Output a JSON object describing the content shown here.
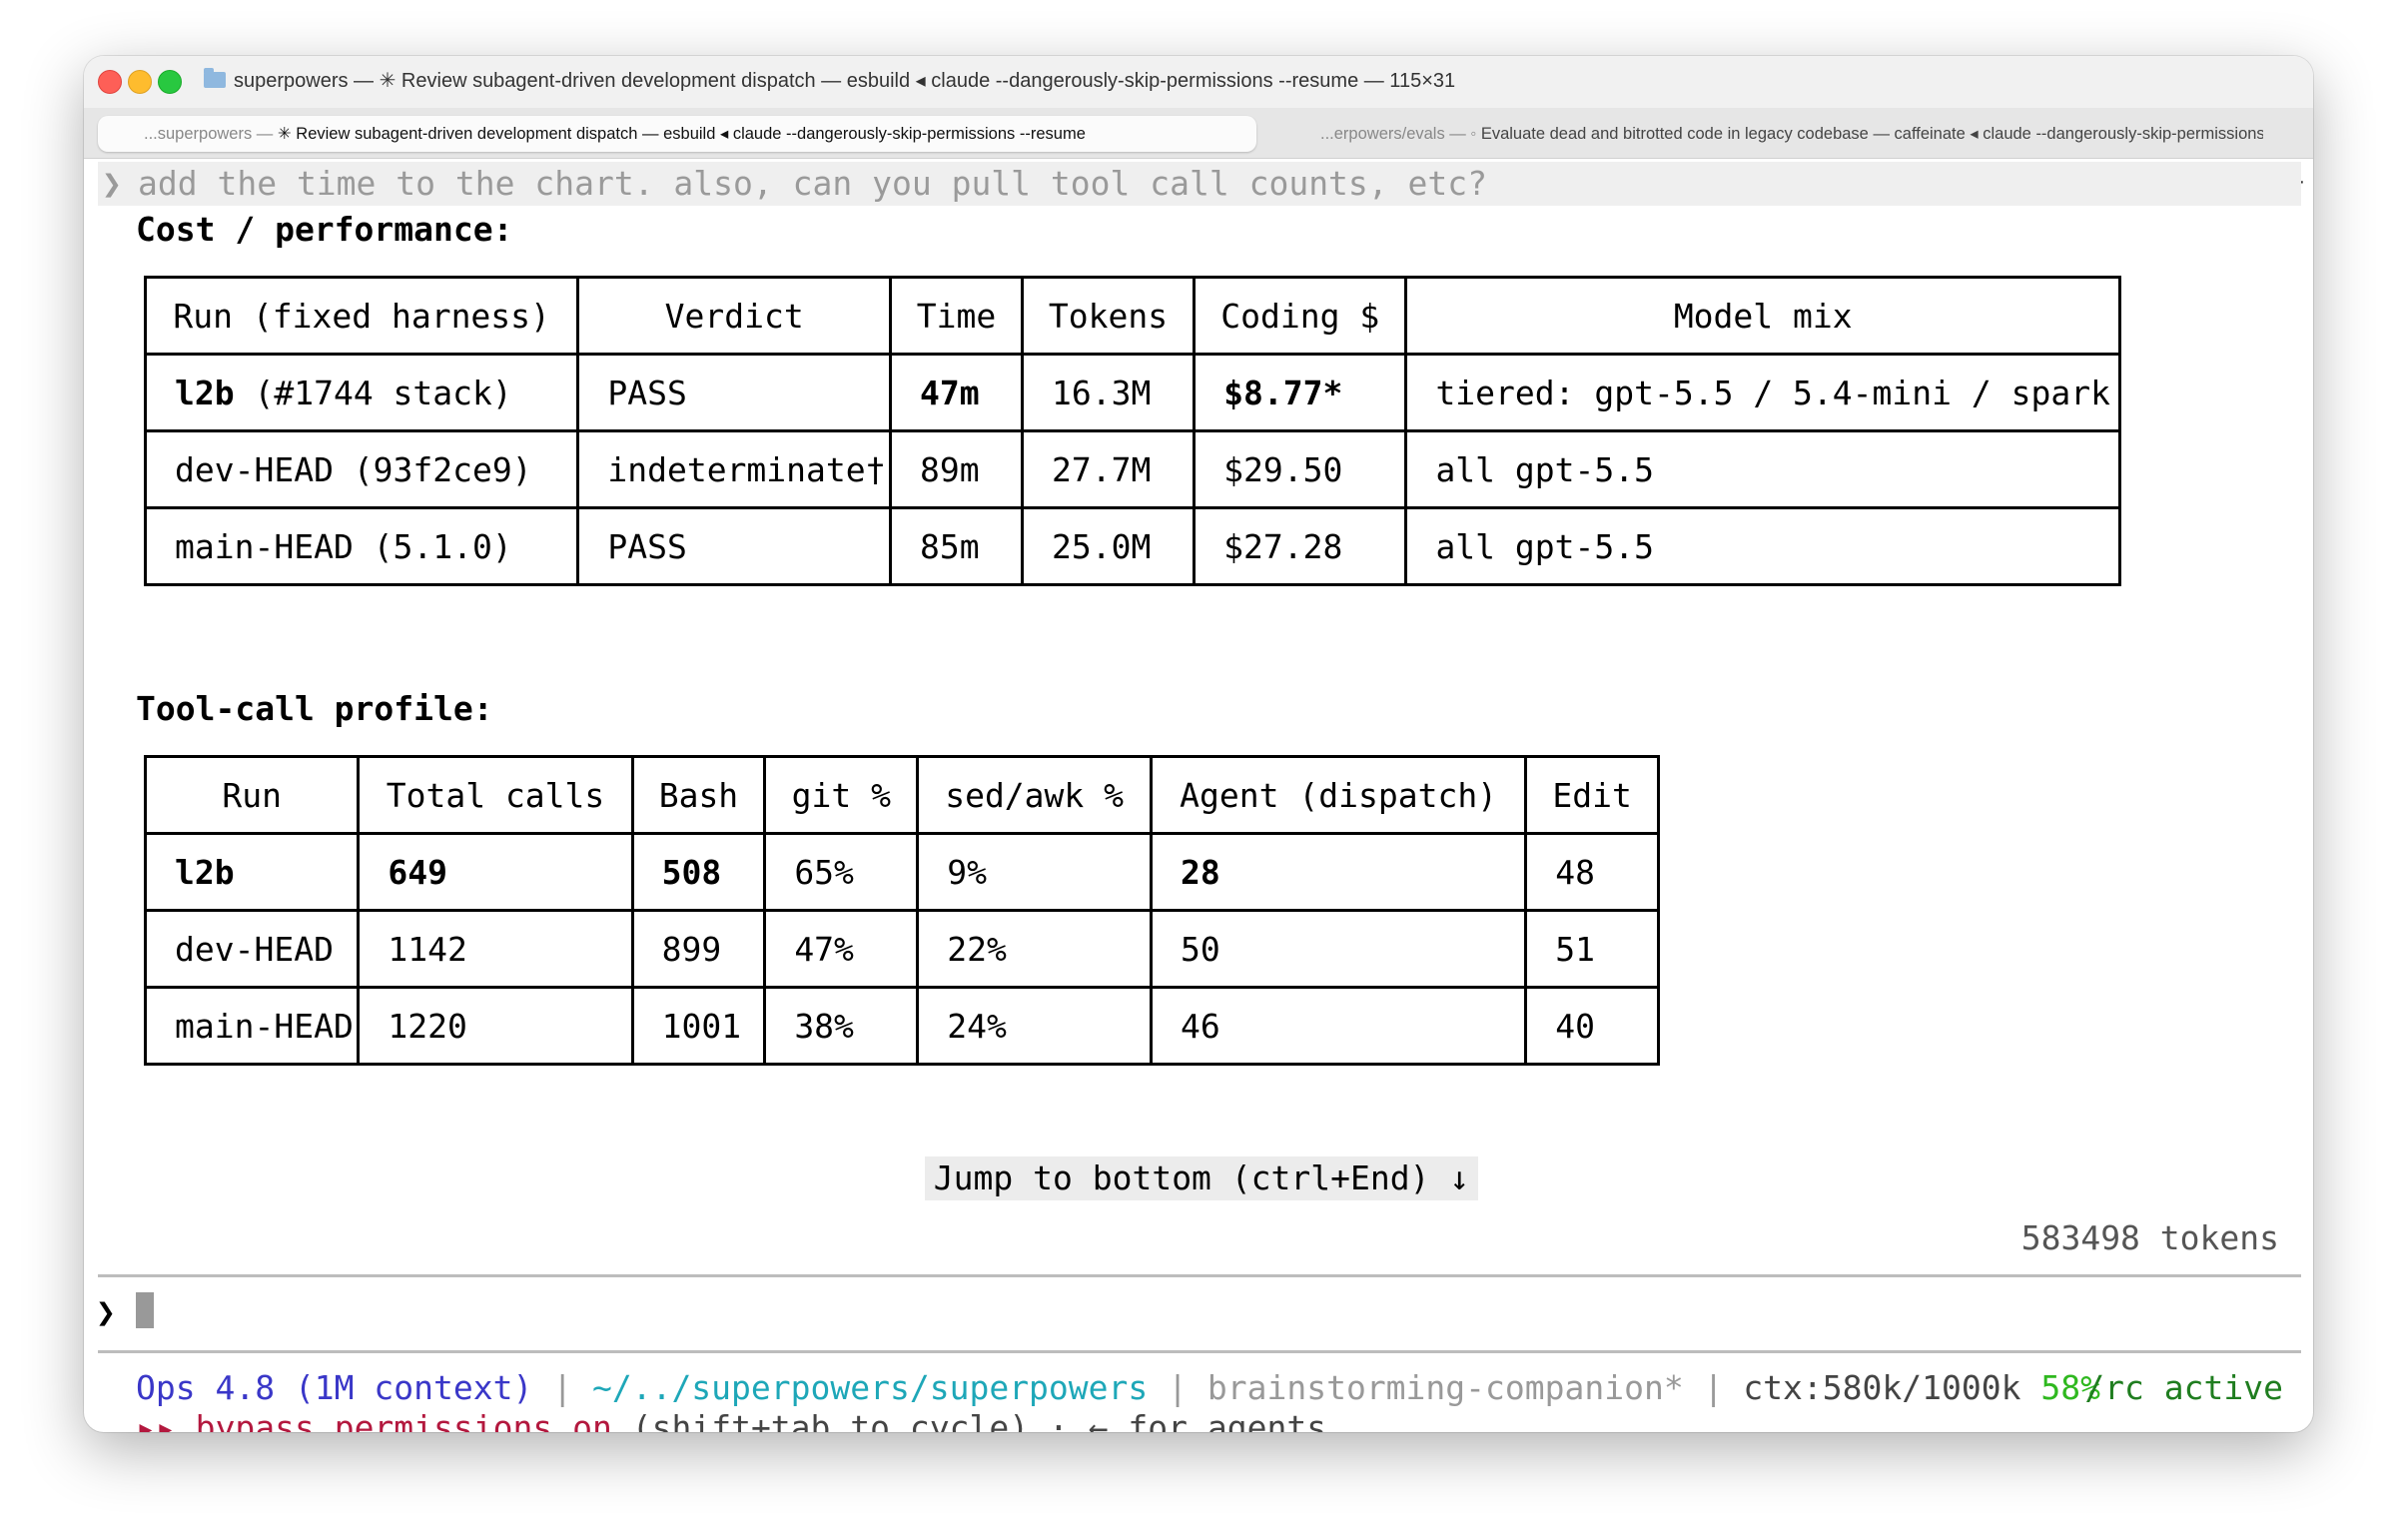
{
  "window": {
    "title": "superpowers — ✳ Review subagent-driven development dispatch — esbuild ◂ claude --dangerously-skip-permissions --resume — 115×31"
  },
  "tabs": [
    {
      "prefix": "...superpowers — ",
      "label": "✳ Review subagent-driven development dispatch — esbuild ◂ claude --dangerously-skip-permissions --resume"
    },
    {
      "prefix": "...erpowers/evals — ◦",
      "label": "Evaluate dead and bitrotted code in legacy codebase — caffeinate ◂ claude --dangerously-skip-permissions"
    }
  ],
  "terminal": {
    "prev_prompt": "add the time to the chart. also, can you pull tool call counts, etc?",
    "prompt_glyph": "❯",
    "cost_heading": "Cost / performance:",
    "cost_table": {
      "headers": [
        "Run (fixed harness)",
        "Verdict",
        "Time",
        "Tokens",
        "Coding $",
        "Model mix"
      ],
      "rows": [
        [
          "l2b",
          " (#1744 stack)",
          "PASS",
          "47m",
          "16.3M",
          "$8.77*",
          "tiered: gpt-5.5 / 5.4-mini / spark"
        ],
        [
          "dev-HEAD (93f2ce9)",
          "",
          "indeterminate†",
          "89m",
          "27.7M",
          "$29.50",
          "all gpt-5.5"
        ],
        [
          "main-HEAD (5.1.0)",
          "",
          "PASS",
          "85m",
          "25.0M",
          "$27.28",
          "all gpt-5.5"
        ]
      ]
    },
    "tool_heading": "Tool-call profile:",
    "tool_table": {
      "headers": [
        "Run",
        "Total calls",
        "Bash",
        "git %",
        "sed/awk %",
        "Agent (dispatch)",
        "Edit"
      ],
      "rows": [
        [
          "l2b",
          "649",
          "508",
          "65%",
          "9%",
          "28",
          "48"
        ],
        [
          "dev-HEAD",
          "1142",
          "899",
          "47%",
          "22%",
          "50",
          "51"
        ],
        [
          "main-HEAD",
          "1220",
          "1001",
          "38%",
          "24%",
          "46",
          "40"
        ]
      ]
    },
    "jump_label": "Jump to bottom (ctrl+End) ↓",
    "token_count": "583498 tokens",
    "status": {
      "model": "Ops 4.8 (1M context)",
      "sep": " | ",
      "path": "~/../superpowers/superpowers",
      "branch": "brainstorming-companion*",
      "ctx": "ctx:580k/1000k",
      "ctx_pct": "58%",
      "rc": "/rc active",
      "mode_arrows": "▸▸",
      "mode": "bypass permissions on",
      "mode_hint": "(shift+tab to cycle) · ← for agents"
    }
  }
}
